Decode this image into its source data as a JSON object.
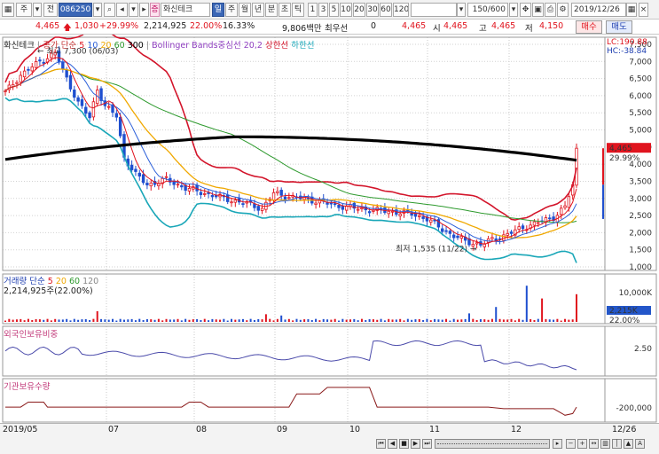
{
  "toolbar": {
    "code": "086250",
    "name": "화신테크",
    "label_tab_jeon": "전",
    "label_tab_ju": "주",
    "periods": [
      "일",
      "주",
      "월",
      "년",
      "분",
      "초",
      "틱"
    ],
    "numbers": [
      "1",
      "3",
      "5",
      "10",
      "20",
      "30",
      "60",
      "120"
    ],
    "count": "150/600",
    "date": "2019/12/26",
    "icon_names": [
      "dropdown-icon",
      "search-icon",
      "prev-icon",
      "next-icon",
      "settings-icon"
    ]
  },
  "quote": {
    "price": "4,465",
    "change": "1,030",
    "change_pct": "+29.99%",
    "volume": "2,214,925",
    "vol_pct": "22.00%",
    "turnover_pct": "16.33%",
    "amount": "9,806백만",
    "best_label": "최우선",
    "best_value": "0",
    "current": "4,465",
    "open_label": "시",
    "open": "4,465",
    "high_label": "고",
    "high": "4,465",
    "low_label": "저",
    "low": "4,150",
    "buy_label": "매수",
    "sell_label": "매도"
  },
  "price_panel": {
    "name": "화신테크",
    "legend_close": "종가 단순",
    "ma": [
      "5",
      "10",
      "20",
      "60",
      "300"
    ],
    "bollinger": "Bollinger Bands중심선 20,2",
    "upper": "상한선",
    "lower": "하한선",
    "lc": "LC:190.88",
    "hc": "HC:-38.84",
    "y_ticks": [
      "7,500",
      "7,000",
      "6,500",
      "6,000",
      "5,500",
      "5,000",
      "4,500",
      "4,000",
      "3,500",
      "3,000",
      "2,500",
      "2,000",
      "1,500",
      "1,000"
    ],
    "current_tag": "4,465",
    "current_pct": "29.99%",
    "high_note": "최고 7,300 (06/03)",
    "low_note": "최저 1,535 (11/22)"
  },
  "volume_panel": {
    "legend": "거래량 단순",
    "ma": [
      "5",
      "20",
      "60",
      "120"
    ],
    "value_line": "2,214,925주(22.00%)",
    "y_tick": "10,000K",
    "current_tag": "2,215K",
    "pct_tag": "22.00%"
  },
  "foreign_panel": {
    "legend": "외국인보유비중",
    "y_tick": "2.50"
  },
  "inst_panel": {
    "legend": "기관보유수량",
    "y_tick": "-200,000"
  },
  "x_axis": {
    "labels": [
      "2019/05",
      "07",
      "08",
      "09",
      "10",
      "11",
      "12",
      "12/26"
    ]
  },
  "colors": {
    "up": "#e0141e",
    "down": "#1f4fcf",
    "ma5": "#e0141e",
    "ma10": "#2b5fd9",
    "ma20": "#f0a800",
    "ma60": "#2e9a2e",
    "ma300": "#000000",
    "bb_upper": "#d3152b",
    "bb_lower": "#1aa7b8"
  }
}
